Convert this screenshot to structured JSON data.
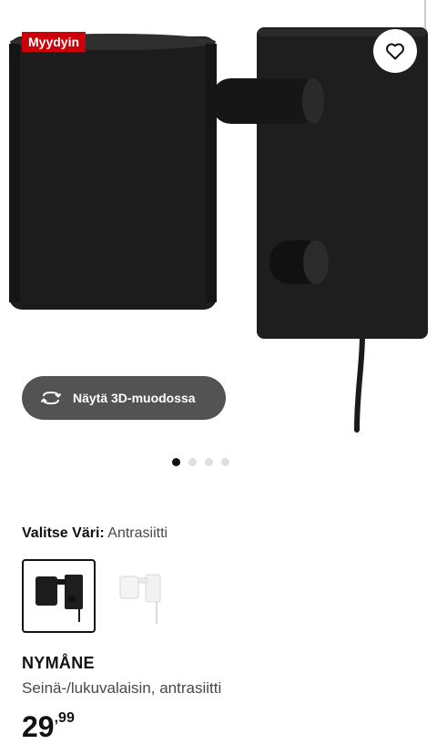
{
  "hero": {
    "badge": "Myydyin",
    "favourite_icon": "heart-icon",
    "view3d": {
      "label": "Näytä 3D-muodossa",
      "icon": "rotate-icon"
    },
    "carousel": {
      "total": 4,
      "active_index": 0
    }
  },
  "color_selector": {
    "label": "Valitse Väri:",
    "value": "Antrasiitti",
    "options": [
      "Antrasiitti",
      "Valkoinen"
    ],
    "selected_index": 0
  },
  "product": {
    "name": "NYMÅNE",
    "description": "Seinä-/lukuvalaisin, antrasiitti",
    "price_integer": "29",
    "price_separator": ",",
    "price_decimals": "99"
  },
  "colors": {
    "badge_bg": "#cc0008",
    "lamp": "#1c1c1c",
    "button_bg": "#444444"
  }
}
